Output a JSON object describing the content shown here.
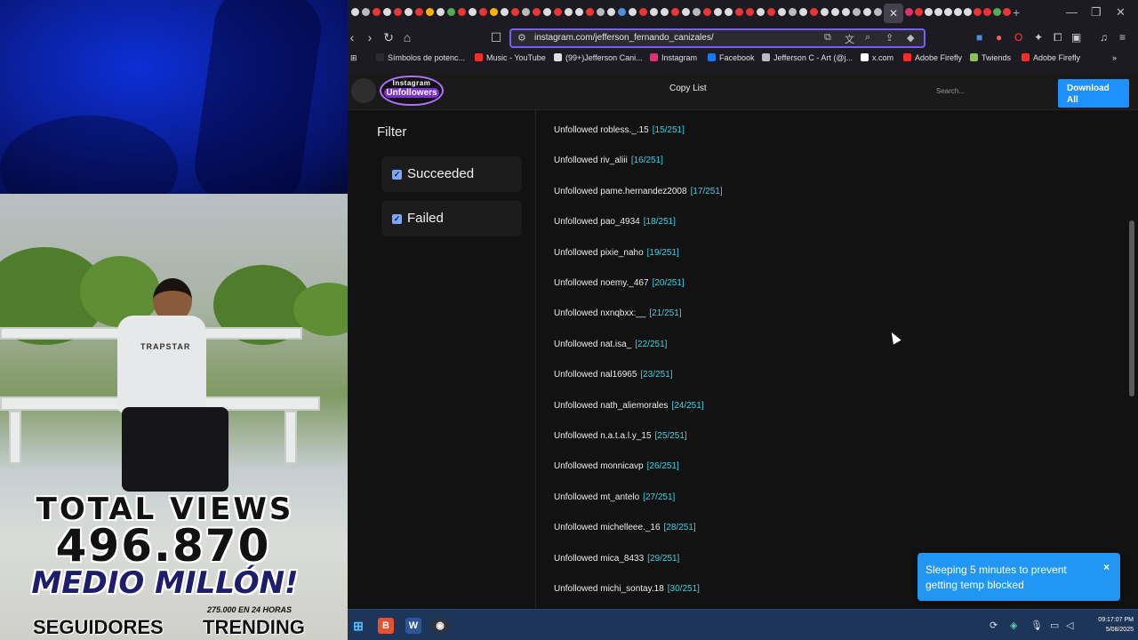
{
  "overlay": {
    "total_views": "TOTAL VIEWS",
    "views_number": "496.870",
    "medio_millon": "MEDIO MILLÓN!",
    "sub_caption": "275.000 EN 24 HORAS",
    "seguidores": "SEGUIDORES",
    "trending": "TRENDING",
    "shirt_text": "TRAPSTAR"
  },
  "browser": {
    "url": "instagram.com/jefferson_fernando_canizales/",
    "bookmarks": [
      {
        "label": "Símbolos de potenc...",
        "color": "#2b2a33"
      },
      {
        "label": "Music - YouTube",
        "color": "#ff2a2a"
      },
      {
        "label": "(99+)Jefferson Cani...",
        "color": "#e0e0e0"
      },
      {
        "label": "Instagram",
        "color": "#e1306c"
      },
      {
        "label": "Facebook",
        "color": "#1877f2"
      },
      {
        "label": "Jefferson C - Art (@j...",
        "color": "#bbbbbb"
      },
      {
        "label": "x.com",
        "color": "#ffffff"
      },
      {
        "label": "Adobe Firefly",
        "color": "#ff2a2a"
      },
      {
        "label": "Twiends",
        "color": "#8bc34a"
      },
      {
        "label": "Adobe Firefly",
        "color": "#ff2a2a"
      }
    ]
  },
  "app": {
    "logo_top": "Instagram",
    "logo_bottom": "Unfollowers",
    "copy_list": "Copy List",
    "search_placeholder": "Search...",
    "download_all": "Download All",
    "filter_title": "Filter",
    "filters": [
      {
        "label": "Succeeded",
        "checked": true
      },
      {
        "label": "Failed",
        "checked": true
      }
    ],
    "log": [
      {
        "text": "Unfollowed robless._.15",
        "count": "[15/251]"
      },
      {
        "text": "Unfollowed riv_aliii",
        "count": "[16/251]"
      },
      {
        "text": "Unfollowed pame.hernandez2008",
        "count": "[17/251]"
      },
      {
        "text": "Unfollowed pao_4934",
        "count": "[18/251]"
      },
      {
        "text": "Unfollowed pixie_naho",
        "count": "[19/251]"
      },
      {
        "text": "Unfollowed noemy._467",
        "count": "[20/251]"
      },
      {
        "text": "Unfollowed nxnqbxx:__",
        "count": "[21/251]"
      },
      {
        "text": "Unfollowed nat.isa_",
        "count": "[22/251]"
      },
      {
        "text": "Unfollowed nal16965",
        "count": "[23/251]"
      },
      {
        "text": "Unfollowed nath_aliemorales",
        "count": "[24/251]"
      },
      {
        "text": "Unfollowed n.a.t.a.l.y_15",
        "count": "[25/251]"
      },
      {
        "text": "Unfollowed monnicavp",
        "count": "[26/251]"
      },
      {
        "text": "Unfollowed mt_antelo",
        "count": "[27/251]"
      },
      {
        "text": "Unfollowed michelleee._16",
        "count": "[28/251]"
      },
      {
        "text": "Unfollowed mica_8433",
        "count": "[29/251]"
      },
      {
        "text": "Unfollowed michi_sontay.18",
        "count": "[30/251]"
      }
    ],
    "toast": "Sleeping 5 minutes to prevent getting temp blocked",
    "toast_close": "×"
  },
  "taskbar": {
    "time": "09:17:07 PM",
    "date": "5/08/2025"
  }
}
